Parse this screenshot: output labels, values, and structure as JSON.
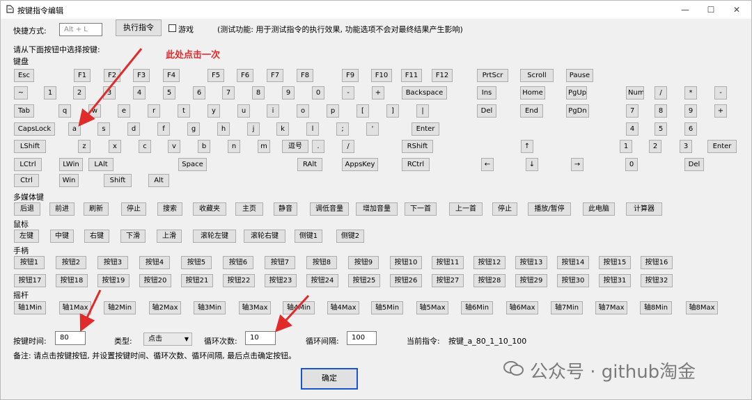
{
  "window": {
    "title": "按键指令编辑",
    "minimize": "—",
    "maximize": "☐",
    "close": "✕"
  },
  "top": {
    "shortcut_label": "快捷方式:",
    "shortcut_placeholder": "Alt + L",
    "execute_button": "执行指令",
    "game_checkbox_label": "游戏",
    "test_note": "(测试功能: 用于测试指令的执行效果, 功能选项不会对最终结果产生影响)"
  },
  "instruction": "请从下面按钮中选择按键:",
  "annotation": "此处点击一次",
  "sections": {
    "keyboard": "键盘",
    "media": "多媒体键",
    "mouse": "鼠标",
    "gamepad": "手柄",
    "joystick": "摇杆"
  },
  "keyboard": {
    "row1": [
      "Esc",
      "F1",
      "F2",
      "F3",
      "F4",
      "F5",
      "F6",
      "F7",
      "F8",
      "F9",
      "F10",
      "F11",
      "F12",
      "PrtScr",
      "Scroll",
      "Pause"
    ],
    "row2": [
      "~",
      "1",
      "2",
      "3",
      "4",
      "5",
      "6",
      "7",
      "8",
      "9",
      "0",
      "-",
      "+",
      "Backspace",
      "Ins",
      "Home",
      "PgUp",
      "Num",
      "/",
      "*",
      "-"
    ],
    "row3": [
      "Tab",
      "q",
      "w",
      "e",
      "r",
      "t",
      "y",
      "u",
      "i",
      "o",
      "p",
      "[",
      "]",
      "|",
      "Del",
      "End",
      "PgDn",
      "7",
      "8",
      "9",
      "+"
    ],
    "row4": [
      "CapsLock",
      "a",
      "s",
      "d",
      "f",
      "g",
      "h",
      "j",
      "k",
      "l",
      ";",
      "'",
      "Enter",
      "4",
      "5",
      "6"
    ],
    "row5": [
      "LShift",
      "z",
      "x",
      "c",
      "v",
      "b",
      "n",
      "m",
      "逗号",
      ".",
      "/",
      "RShift",
      "↑",
      "1",
      "2",
      "3",
      "Enter"
    ],
    "row6": [
      "LCtrl",
      "LWin",
      "LAlt",
      "Space",
      "RAlt",
      "AppsKey",
      "RCtrl",
      "←",
      "↓",
      "→",
      "0",
      "Del"
    ],
    "row7": [
      "Ctrl",
      "Win",
      "Shift",
      "Alt"
    ]
  },
  "media": [
    "后退",
    "前进",
    "刷新",
    "停止",
    "搜索",
    "收藏夹",
    "主页",
    "静音",
    "调低音量",
    "增加音量",
    "下一首",
    "上一首",
    "停止",
    "播放/暂停",
    "此电脑",
    "计算器"
  ],
  "mouse": [
    "左键",
    "中键",
    "右键",
    "下滑",
    "上滑",
    "滚轮左键",
    "滚轮右键",
    "侧键1",
    "侧键2"
  ],
  "gamepad_row1": [
    "按钮1",
    "按钮2",
    "按钮3",
    "按钮4",
    "按钮5",
    "按钮6",
    "按钮7",
    "按钮8",
    "按钮9",
    "按钮10",
    "按钮11",
    "按钮12",
    "按钮13",
    "按钮14",
    "按钮15",
    "按钮16"
  ],
  "gamepad_row2": [
    "按钮17",
    "按钮18",
    "按钮19",
    "按钮20",
    "按钮21",
    "按钮22",
    "按钮23",
    "按钮24",
    "按钮25",
    "按钮26",
    "按钮27",
    "按钮28",
    "按钮29",
    "按钮30",
    "按钮31",
    "按钮32"
  ],
  "joystick": [
    "轴1Min",
    "轴1Max",
    "轴2Min",
    "轴2Max",
    "轴3Min",
    "轴3Max",
    "轴4Min",
    "轴4Max",
    "轴5Min",
    "轴5Max",
    "轴6Min",
    "轴6Max",
    "轴7Min",
    "轴7Max",
    "轴8Min",
    "轴8Max"
  ],
  "bottom": {
    "press_time_label": "按键时间:",
    "press_time_value": "80",
    "type_label": "类型:",
    "type_value": "点击",
    "loop_count_label": "循环次数:",
    "loop_count_value": "10",
    "loop_interval_label": "循环间隔:",
    "loop_interval_value": "100",
    "current_command_label": "当前指令:",
    "current_command_value": "按键_a_80_1_10_100",
    "remark": "备注: 请点击按键按钮, 并设置按键时间、循环次数、循环间隔, 最后点击确定按钮。",
    "confirm": "确定"
  },
  "watermark": "公众号 · github淘金",
  "colors": {
    "annotation": "#e12a2a",
    "default_border": "#1a55c8"
  }
}
